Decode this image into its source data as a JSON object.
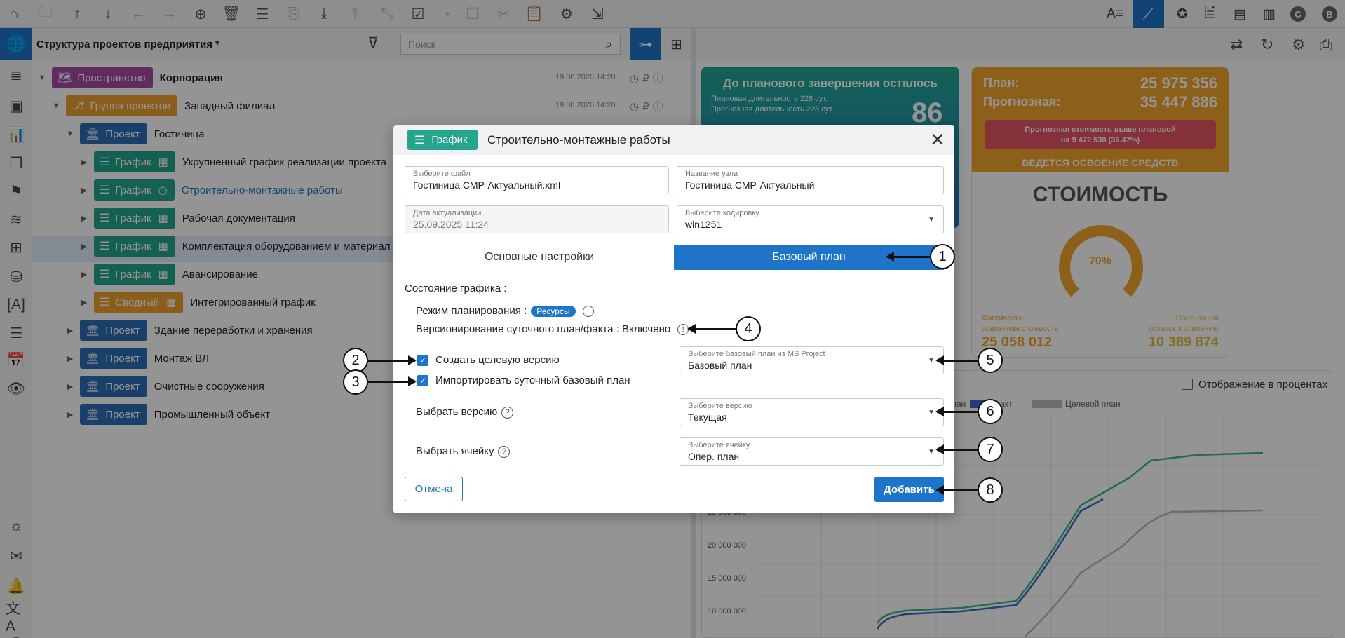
{
  "tree": {
    "title": "Структура проектов предприятия",
    "search_placeholder": "Поиск",
    "rows": [
      {
        "badge": "Пространство",
        "label": "Корпорация",
        "date": "19.08.2026 14:20"
      },
      {
        "badge": "Группа проектов",
        "label": "Западный филиал",
        "date": "19.08.2026 14:20"
      },
      {
        "badge": "Проект",
        "label": "Гостиница"
      },
      {
        "badge": "График",
        "label": "Укрупненный график реализации проекта"
      },
      {
        "badge": "График",
        "label": "Строительно-монтажные работы"
      },
      {
        "badge": "График",
        "label": "Рабочая документация"
      },
      {
        "badge": "График",
        "label": "Комплектация оборудованием и материал"
      },
      {
        "badge": "График",
        "label": "Авансирование"
      },
      {
        "badge": "Сводный",
        "label": "Интегрированный график"
      },
      {
        "badge": "Проект",
        "label": "Здание переработки и хранения"
      },
      {
        "badge": "Проект",
        "label": "Монтаж ВЛ"
      },
      {
        "badge": "Проект",
        "label": "Очистные сооружения"
      },
      {
        "badge": "Проект",
        "label": "Промышленный объект"
      }
    ]
  },
  "dashboard": {
    "card1": {
      "title": "До планового завершения осталось",
      "planned": "Плановая длительность 228 сут.",
      "forecast": "Прогнозная длительность 228 сут.",
      "value": "86"
    },
    "card2": {
      "plan_label": "План:",
      "plan_value": "25 975 356",
      "forecast_label": "Прогнозная:",
      "forecast_value": "35 447 886",
      "alert_line1": "Прогнозная стоимость выше плановой",
      "alert_line2": "на 9 472 530 (36.47%)",
      "status": "ВЕДЕТСЯ ОСВОЕНИЕ СРЕДСТВ",
      "heading": "СТОИМОСТЬ",
      "gauge": "70%",
      "actual_label1": "Фактически",
      "actual_label2": "освоенная стоимость",
      "actual_value": "25 058 012",
      "forecast_rest1": "Прогнозный",
      "forecast_rest2": "остаток к освоению",
      "forecast_rest_value": "10 389 874"
    },
    "chart": {
      "toggle_label": "Отображение в процентах",
      "legend_partial": "лан",
      "legend_fact": "Факт",
      "legend_target": "Целевой план",
      "yticks": [
        "25 000 000",
        "20 000 000",
        "15 000 000",
        "10 000 000"
      ]
    }
  },
  "modal": {
    "badge": "График",
    "title": "Строительно-монтажные работы",
    "file_label": "Выберите файл",
    "file_value": "Гостиница СМР-Актуальный.xml",
    "node_label": "Название узла",
    "node_value": "Гостиница СМР-Актуальный",
    "date_label": "Дата актуализации",
    "date_value": "25.09.2025 11:24",
    "enc_label": "Выберите кодировку",
    "enc_value": "win1251",
    "tab_main": "Основные настройки",
    "tab_base": "Базовый план",
    "state_label": "Состояние графика :",
    "mode_label": "Режим планирования :",
    "mode_value": "Ресурсы",
    "versioning": "Версионирование суточного план/факта : Включено",
    "cb1": "Создать целевую версию",
    "cb2": "Импортировать суточный базовый план",
    "msp_label": "Выберите базовый план из MS Project",
    "msp_value": "Базовый план",
    "ver_text": "Выбрать версию",
    "ver_label": "Выберите версию",
    "ver_value": "Текущая",
    "cell_text": "Выбрать ячейку",
    "cell_label": "Выберите ячейку",
    "cell_value": "Опер. план",
    "cancel": "Отмена",
    "add": "Добавить"
  },
  "callouts": [
    "1",
    "2",
    "3",
    "4",
    "5",
    "6",
    "7",
    "8"
  ],
  "icons": {
    "close": "close-icon",
    "dropdown": "chevron-down-icon",
    "schedule": "gantt-icon",
    "info": "info-icon",
    "help": "question-icon"
  },
  "colors": {
    "accent": "#1e74c9",
    "schedule": "#23a58e",
    "space": "#a84aa8",
    "group": "#f0a030",
    "project": "#2c6fb8"
  }
}
